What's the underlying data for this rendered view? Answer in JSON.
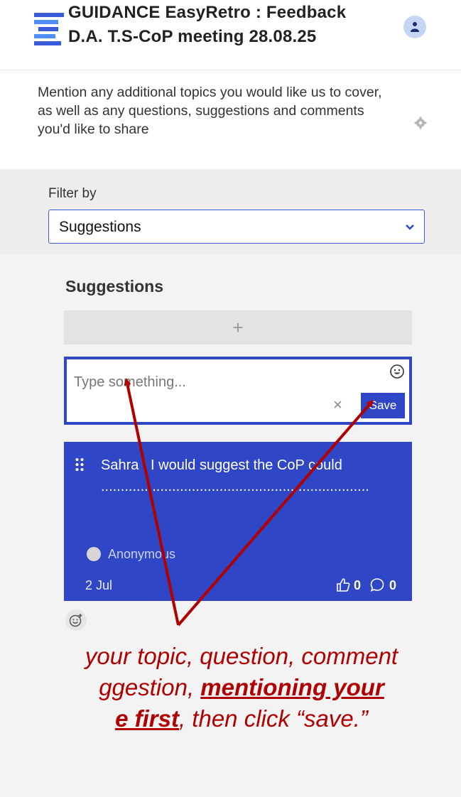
{
  "header": {
    "title_line1": "GUIDANCE EasyRetro : Feedback",
    "title_line2": "D.A. T.S-CoP meeting 28.08.25"
  },
  "board": {
    "description": "Mention any additional topics you would like us to cover, as well as any questions, suggestions and comments you'd like to share"
  },
  "filter": {
    "label": "Filter by",
    "selected": "Suggestions"
  },
  "column": {
    "title": "Suggestions",
    "add_symbol": "+"
  },
  "composer": {
    "placeholder": "Type something...",
    "value": "",
    "cancel_symbol": "×",
    "save_label": "Save"
  },
  "card": {
    "text": "Sahra : I would suggest the CoP could ....................................................................",
    "author": "Anonymous",
    "date": "2 Jul",
    "likes": "0",
    "comments": "0"
  },
  "annotation": {
    "part1": "your topic, question, comment",
    "part2a": "ggestion, ",
    "part2b": "mentioning your",
    "part3a": "e first",
    "part3b": ", then click “save.”"
  },
  "colors": {
    "accent": "#2f47c7",
    "annotation": "#b00000"
  }
}
